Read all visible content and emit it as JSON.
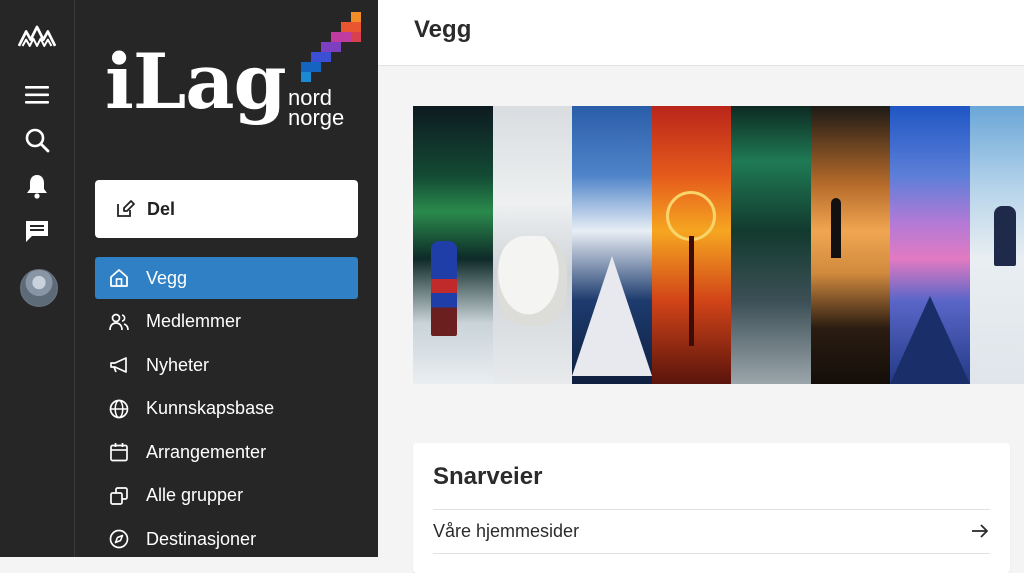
{
  "rail": {
    "icons": [
      "mountain-logo-icon",
      "menu-icon",
      "search-icon",
      "bell-icon",
      "chat-icon",
      "avatar"
    ]
  },
  "brand": {
    "name": "iLag",
    "sub1": "nord",
    "sub2": "norge",
    "colors": [
      "#1565c0",
      "#3b4fd4",
      "#7b3fbf",
      "#c03ba0",
      "#e8552e",
      "#f28c28"
    ]
  },
  "nav": {
    "share_label": "Del",
    "items": [
      {
        "label": "Vegg",
        "icon": "home-icon",
        "active": true
      },
      {
        "label": "Medlemmer",
        "icon": "users-icon",
        "active": false
      },
      {
        "label": "Nyheter",
        "icon": "megaphone-icon",
        "active": false
      },
      {
        "label": "Kunnskapsbase",
        "icon": "globe-icon",
        "active": false
      },
      {
        "label": "Arrangementer",
        "icon": "calendar-icon",
        "active": false
      },
      {
        "label": "Alle grupper",
        "icon": "groups-icon",
        "active": false
      },
      {
        "label": "Destinasjoner",
        "icon": "compass-icon",
        "active": false
      }
    ]
  },
  "header": {
    "title": "Vegg"
  },
  "shortcuts": {
    "title": "Snarveier",
    "links": [
      {
        "label": "Våre hjemmesider",
        "icon": "arrow-right-icon"
      }
    ]
  },
  "colors": {
    "accent": "#2f80c5",
    "sidebar": "#262626"
  }
}
